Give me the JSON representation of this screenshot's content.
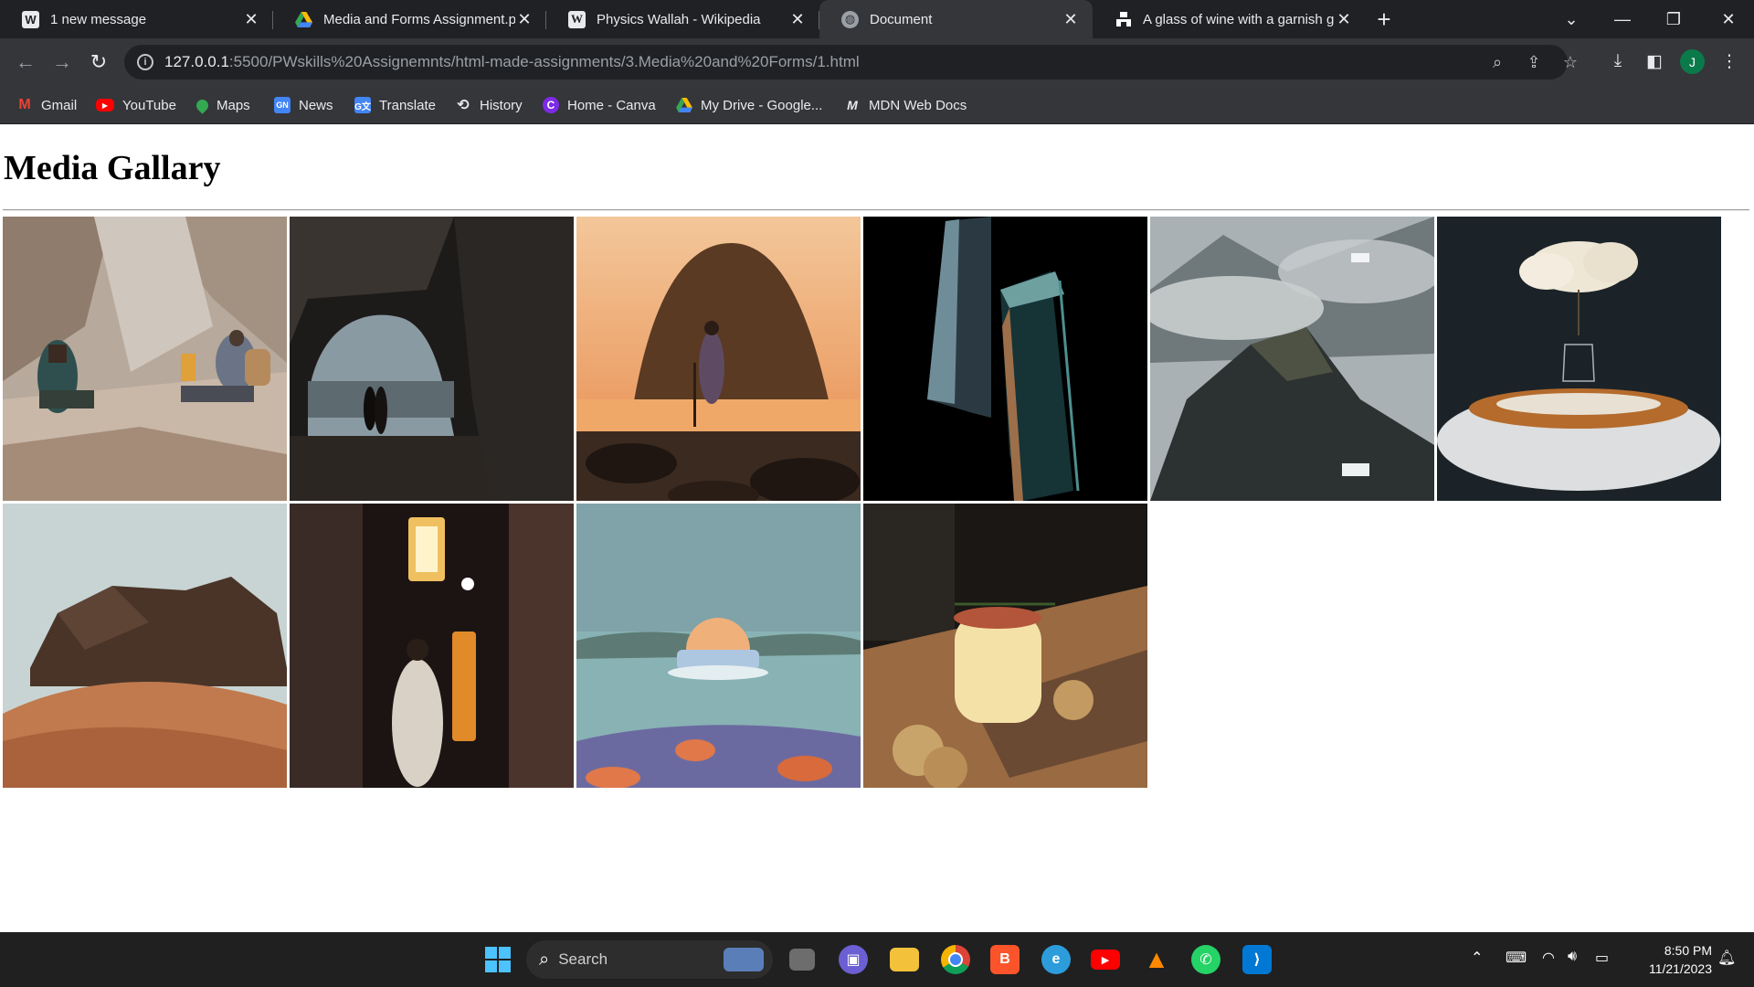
{
  "tabs": [
    {
      "title": "1 new message",
      "favicon": "wordpress-icon",
      "active": false
    },
    {
      "title": "Media and Forms Assignment.pdf",
      "favicon": "google-drive-icon",
      "active": false
    },
    {
      "title": "Physics Wallah - Wikipedia",
      "favicon": "wikipedia-icon",
      "active": false
    },
    {
      "title": "Document",
      "favicon": "globe-icon",
      "active": true
    },
    {
      "title": "A glass of wine with a garnish g",
      "favicon": "unsplash-icon",
      "active": false
    }
  ],
  "address": {
    "host": "127.0.0.1",
    "path": ":5500/PWskills%20Assignemnts/html-made-assignments/3.Media%20and%20Forms/1.html"
  },
  "profile_initial": "J",
  "bookmarks": [
    {
      "label": "Gmail",
      "icon": "gmail-icon",
      "color": "#ea4335"
    },
    {
      "label": "YouTube",
      "icon": "youtube-icon",
      "color": "#ff0000"
    },
    {
      "label": "Maps",
      "icon": "maps-icon",
      "color": "#34a853"
    },
    {
      "label": "News",
      "icon": "news-icon",
      "color": "#4285f4"
    },
    {
      "label": "Translate",
      "icon": "translate-icon",
      "color": "#4285f4"
    },
    {
      "label": "History",
      "icon": "history-icon",
      "color": "#35363a"
    },
    {
      "label": "Home - Canva",
      "icon": "canva-icon",
      "color": "#7d2ae8"
    },
    {
      "label": "My Drive - Google...",
      "icon": "google-drive-icon",
      "color": "#fbbc04"
    },
    {
      "label": "MDN Web Docs",
      "icon": "mdn-icon",
      "color": "#000000"
    }
  ],
  "page": {
    "heading": "Media Gallary"
  },
  "gallery": [
    {
      "name": "hikers-in-canyon-photo"
    },
    {
      "name": "couple-in-sea-cave-photo"
    },
    {
      "name": "woman-at-sunset-beach-photo"
    },
    {
      "name": "glass-prisms-photo"
    },
    {
      "name": "misty-mountain-photo"
    },
    {
      "name": "floating-cloud-island-photo"
    },
    {
      "name": "desert-rock-formation-photo"
    },
    {
      "name": "japanese-alley-kimono-photo"
    },
    {
      "name": "sofa-on-lake-render-photo"
    },
    {
      "name": "cocktail-glass-photo"
    }
  ],
  "taskbar": {
    "search_label": "Search",
    "time": "8:50 PM",
    "date": "11/21/2023"
  },
  "colors": {
    "tabstrip_bg": "#202124",
    "toolbar_bg": "#35363a",
    "taskbar_bg": "#202020"
  }
}
